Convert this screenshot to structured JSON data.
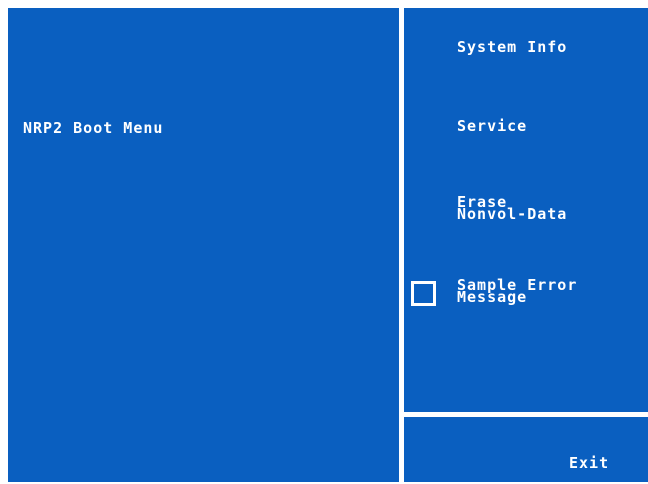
{
  "title": "NRP2 Boot Menu",
  "menu": {
    "items": [
      {
        "label": "System Info"
      },
      {
        "label": "Service"
      },
      {
        "label_line1": "Erase",
        "label_line2": "Nonvol-Data"
      },
      {
        "label_line1": "Sample Error",
        "label_line2": "Message",
        "checked": false
      }
    ],
    "exit_label": "Exit"
  },
  "colors": {
    "panel": "#0a5fc0",
    "text": "#ffffff",
    "divider": "#ffffff"
  }
}
